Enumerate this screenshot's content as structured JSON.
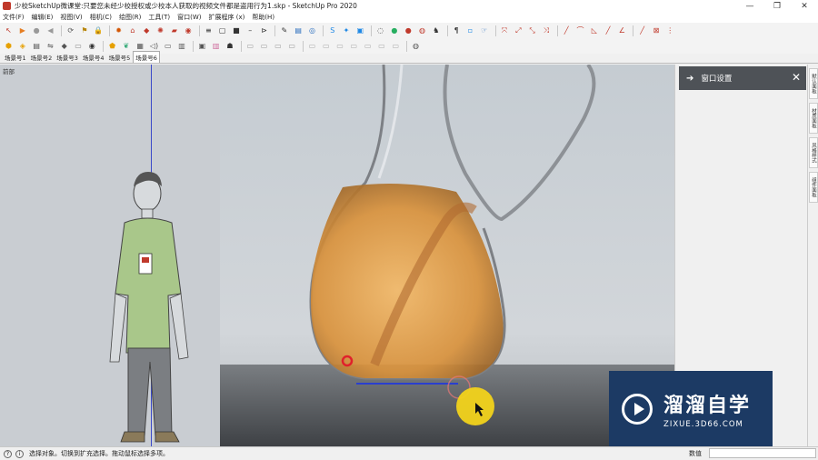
{
  "window": {
    "title": "少校SketchUp微课堂:只要您未经少校授权或少校本人获取的视频文件都是盗用行为1.skp - SketchUp Pro 2020",
    "minimize": "—",
    "maximize": "❐",
    "close": "✕"
  },
  "menu": [
    "文件(F)",
    "编辑(E)",
    "视图(V)",
    "相机(C)",
    "绘图(R)",
    "工具(T)",
    "窗口(W)",
    "扩展程序 (x)",
    "帮助(H)"
  ],
  "scenes": {
    "tabs": [
      "场景号1",
      "场景号2",
      "场景号3",
      "场景号4",
      "场景号5",
      "场景号6"
    ],
    "active": 5
  },
  "viewport": {
    "label": "前部"
  },
  "panel": {
    "title": "窗口设置",
    "arrow": "➔",
    "close": "✕"
  },
  "sidetabs": [
    "默认面板",
    "材质面板",
    "风格样式",
    "组件面板"
  ],
  "status": {
    "text": "选择对象。切换到扩充选择。拖动鼠标选择多项。",
    "measure_label": "数值",
    "icon_help": "?",
    "icon_info": "i"
  },
  "watermark": {
    "cn": "溜溜自学",
    "en": "ZIXUE.3D66.COM"
  },
  "toolbar1": [
    {
      "name": "select-icon",
      "g": "↖",
      "c": "#c0392b"
    },
    {
      "name": "paint-icon",
      "g": "▶",
      "c": "#e67e22"
    },
    {
      "name": "record-icon",
      "g": "●",
      "c": "#999"
    },
    {
      "name": "prev-icon",
      "g": "◀",
      "c": "#999"
    },
    {
      "name": "orbit-icon",
      "g": "⟳",
      "c": "#555"
    },
    {
      "name": "walk-icon",
      "g": "⚑",
      "c": "#b8860b"
    },
    {
      "name": "lock-icon",
      "g": "🔒",
      "c": "#555"
    },
    {
      "name": "gear-icon",
      "g": "✹",
      "c": "#d35400"
    },
    {
      "name": "house-icon",
      "g": "⌂",
      "c": "#c0392b"
    },
    {
      "name": "gem-icon",
      "g": "◆",
      "c": "#c0392b"
    },
    {
      "name": "settings-icon",
      "g": "✺",
      "c": "#c0392b"
    },
    {
      "name": "folder-icon",
      "g": "▰",
      "c": "#c0392b"
    },
    {
      "name": "record-red-icon",
      "g": "◉",
      "c": "#c0392b"
    },
    {
      "name": "list-icon",
      "g": "≡",
      "c": "#333"
    },
    {
      "name": "file-icon",
      "g": "▢",
      "c": "#333"
    },
    {
      "name": "save-icon",
      "g": "■",
      "c": "#333"
    },
    {
      "name": "line-icon",
      "g": "–",
      "c": "#333"
    },
    {
      "name": "tag-icon",
      "g": "⊳",
      "c": "#333"
    },
    {
      "name": "pen-icon",
      "g": "✎",
      "c": "#333"
    },
    {
      "name": "layers-icon",
      "g": "▤",
      "c": "#2c6fbf"
    },
    {
      "name": "target-icon",
      "g": "◎",
      "c": "#2c6fbf"
    },
    {
      "name": "s-icon",
      "g": "S",
      "c": "#1e88e5"
    },
    {
      "name": "star-icon",
      "g": "✦",
      "c": "#1e88e5"
    },
    {
      "name": "box-icon",
      "g": "▣",
      "c": "#1e88e5"
    },
    {
      "name": "circle-icon",
      "g": "◌",
      "c": "#333"
    },
    {
      "name": "globe-icon",
      "g": "●",
      "c": "#27ae60"
    },
    {
      "name": "ruby-icon",
      "g": "●",
      "c": "#c0392b"
    },
    {
      "name": "shape-icon",
      "g": "◍",
      "c": "#c0392b"
    },
    {
      "name": "bird-icon",
      "g": "♞",
      "c": "#333"
    },
    {
      "name": "pin-icon",
      "g": "¶",
      "c": "#333"
    },
    {
      "name": "cube-icon",
      "g": "▫",
      "c": "#1e88e5"
    },
    {
      "name": "thumb-icon",
      "g": "☞",
      "c": "#2c6fbf"
    },
    {
      "name": "arrows-icon",
      "g": "⤧",
      "c": "#c0392b"
    },
    {
      "name": "expand-icon",
      "g": "⤢",
      "c": "#c0392b"
    },
    {
      "name": "fit-icon",
      "g": "⤡",
      "c": "#c0392b"
    },
    {
      "name": "zoom-ext-icon",
      "g": "⤨",
      "c": "#c0392b"
    },
    {
      "name": "line-tool-icon",
      "g": "╱",
      "c": "#c0392b"
    },
    {
      "name": "arc-icon",
      "g": "⌒",
      "c": "#c0392b"
    },
    {
      "name": "triangle-icon",
      "g": "◺",
      "c": "#c0392b"
    },
    {
      "name": "slash-icon",
      "g": "╱",
      "c": "#c0392b"
    },
    {
      "name": "angle-icon",
      "g": "∠",
      "c": "#c0392b"
    },
    {
      "name": "draw-line-icon",
      "g": "╱",
      "c": "#c0392b"
    },
    {
      "name": "cross-box-icon",
      "g": "⊠",
      "c": "#c0392b"
    },
    {
      "name": "grid-icon",
      "g": "⋮",
      "c": "#c0392b"
    }
  ],
  "toolbar2": [
    {
      "name": "soap-icon",
      "g": "⬢",
      "c": "#e6a000"
    },
    {
      "name": "material-icon",
      "g": "◈",
      "c": "#e6a000"
    },
    {
      "name": "cabinet-icon",
      "g": "▤",
      "c": "#555"
    },
    {
      "name": "rotate-icon",
      "g": "⇋",
      "c": "#555"
    },
    {
      "name": "car-icon",
      "g": "◆",
      "c": "#555"
    },
    {
      "name": "brush-icon",
      "g": "▭",
      "c": "#888"
    },
    {
      "name": "eye-icon",
      "g": "◉",
      "c": "#333"
    },
    {
      "name": "shield-icon",
      "g": "⬟",
      "c": "#e6a000"
    },
    {
      "name": "leaf-icon",
      "g": "❦",
      "c": "#3a7"
    },
    {
      "name": "texture-icon",
      "g": "▦",
      "c": "#555"
    },
    {
      "name": "speaker-icon",
      "g": "◁)",
      "c": "#555"
    },
    {
      "name": "rect-icon",
      "g": "▭",
      "c": "#555"
    },
    {
      "name": "quad-icon",
      "g": "▥",
      "c": "#555"
    },
    {
      "name": "card-icon",
      "g": "▣",
      "c": "#555"
    },
    {
      "name": "book-icon",
      "g": "▥",
      "c": "#c69"
    },
    {
      "name": "people-icon",
      "g": "☗",
      "c": "#333"
    },
    {
      "name": "block-a-icon",
      "g": "▭",
      "c": "#999"
    },
    {
      "name": "block-b-icon",
      "g": "▭",
      "c": "#999"
    },
    {
      "name": "block-c-icon",
      "g": "▭",
      "c": "#999"
    },
    {
      "name": "block-d-icon",
      "g": "▭",
      "c": "#999"
    },
    {
      "name": "stack-a-icon",
      "g": "▭",
      "c": "#aaa"
    },
    {
      "name": "stack-b-icon",
      "g": "▭",
      "c": "#aaa"
    },
    {
      "name": "stack-c-icon",
      "g": "▭",
      "c": "#aaa"
    },
    {
      "name": "stack-d-icon",
      "g": "▭",
      "c": "#aaa"
    },
    {
      "name": "stack-e-icon",
      "g": "▭",
      "c": "#aaa"
    },
    {
      "name": "stack-f-icon",
      "g": "▭",
      "c": "#aaa"
    },
    {
      "name": "stack-g-icon",
      "g": "▭",
      "c": "#aaa"
    },
    {
      "name": "sphere-icon",
      "g": "◍",
      "c": "#555"
    }
  ]
}
